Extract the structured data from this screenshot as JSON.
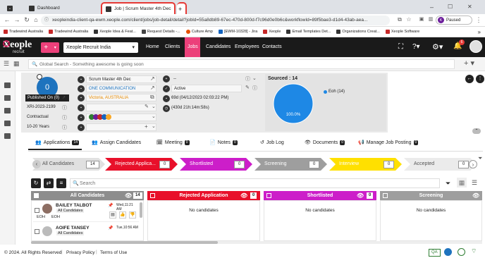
{
  "browser": {
    "tabs": [
      {
        "title": "Dashboard"
      },
      {
        "title": "Job | Scrum Master 4th Dec"
      }
    ],
    "new_tab": "+",
    "url": "xeopleindia-client-qa-ewm.xeople.com/client/jobs/job-detail/detail?jobId=55a8db89-67ec-470d-800d-f7c96d0e0b6c&workflowId=89f5bae3-d1d4-43ab-aea...",
    "profile_status": "Paused",
    "profile_initial": "K",
    "bookmarks": [
      "Tradewind Australia",
      "Tradewind Australia",
      "Xeople Idea & Feat...",
      "Request Details -...",
      "Culture Amp",
      "[EWM-10328] - Jira",
      "Xeople",
      "Email Templates Det...",
      "Organizations Creat...",
      "Xeople Software"
    ]
  },
  "app": {
    "logo": "Xeople",
    "logo_sub": "recruit",
    "add_button": "+",
    "org_selector": "Xeople Recruit India",
    "nav": [
      "Home",
      "Clients",
      "Jobs",
      "Candidates",
      "Employees",
      "Contacts"
    ],
    "active_nav": "Jobs",
    "notifications": "6",
    "search_placeholder": "Global Search - Something awesome is going soon"
  },
  "job": {
    "applicant_count": "0",
    "published_on": "Published On (0)",
    "job_code": "XRI-2023-2199",
    "job_type": "Contractual",
    "experience": "10-20 Years",
    "job_title": "Scrum Master 4th Dec",
    "client": "ONE COMMUNICATION",
    "location": "Victoria, AUSTRALIA",
    "status": "Active",
    "status_dash": "--",
    "days_open": "69d (04/12/2023 02:03:22 PM)",
    "duration": "(430d 21h:14m:58s)",
    "sourced_label": "Sourced : 14",
    "pie_legend": "Eoh (14)",
    "pie_percent": "100.0%"
  },
  "chart_data": {
    "type": "pie",
    "title": "Sourced : 14",
    "categories": [
      "Eoh"
    ],
    "values": [
      14
    ],
    "labels": [
      "100.0%"
    ],
    "colors": [
      "#1e88e5"
    ],
    "legend": "right"
  },
  "detail_tabs": [
    {
      "label": "Applications",
      "count": "14"
    },
    {
      "label": "Assign Candidates",
      "count": ""
    },
    {
      "label": "Meeting",
      "count": "0"
    },
    {
      "label": "Notes",
      "count": "0"
    },
    {
      "label": "Job Log",
      "count": ""
    },
    {
      "label": "Documents",
      "count": "0"
    },
    {
      "label": "Manage Job Posting",
      "count": "0"
    }
  ],
  "pipeline": [
    {
      "label": "All Candidates",
      "count": "14",
      "color": "#e0e0e0"
    },
    {
      "label": "Rejected Applica...",
      "count": "0",
      "color": "#e8102a"
    },
    {
      "label": "Shortlisted",
      "count": "0",
      "color": "#cc1ec9"
    },
    {
      "label": "Screening",
      "count": "0",
      "color": "#9e9e9e"
    },
    {
      "label": "Interview",
      "count": "0",
      "color": "#ffe000"
    },
    {
      "label": "Accepted",
      "count": "0",
      "color": "#ebebeb"
    }
  ],
  "search_placeholder": "Search",
  "columns": [
    {
      "title": "All Candidates",
      "count": "14",
      "color": "#8d8d8d"
    },
    {
      "title": "Rejected Application",
      "count": "0",
      "color": "#e8102a",
      "empty": "No candidates"
    },
    {
      "title": "Shortlisted",
      "count": "0",
      "color": "#cc1ec9",
      "empty": "No candidates"
    },
    {
      "title": "Screening",
      "count": "",
      "color": "#9e9e9e",
      "empty": "No candidates"
    }
  ],
  "candidates": [
    {
      "name": "BAILEY TALBOT",
      "tag": "All Candidates",
      "time": "Wed,11:21 AM",
      "src1": "EOH",
      "src2": "EOH"
    },
    {
      "name": "AOIFE TANSEY",
      "tag": "All Candidates",
      "time": "Tue,10:56 AM"
    }
  ],
  "footer": {
    "copyright": "© 2024. All Rights Reserved",
    "privacy": "Privacy Policy",
    "terms": "Terms of Use",
    "qa": "QA"
  }
}
